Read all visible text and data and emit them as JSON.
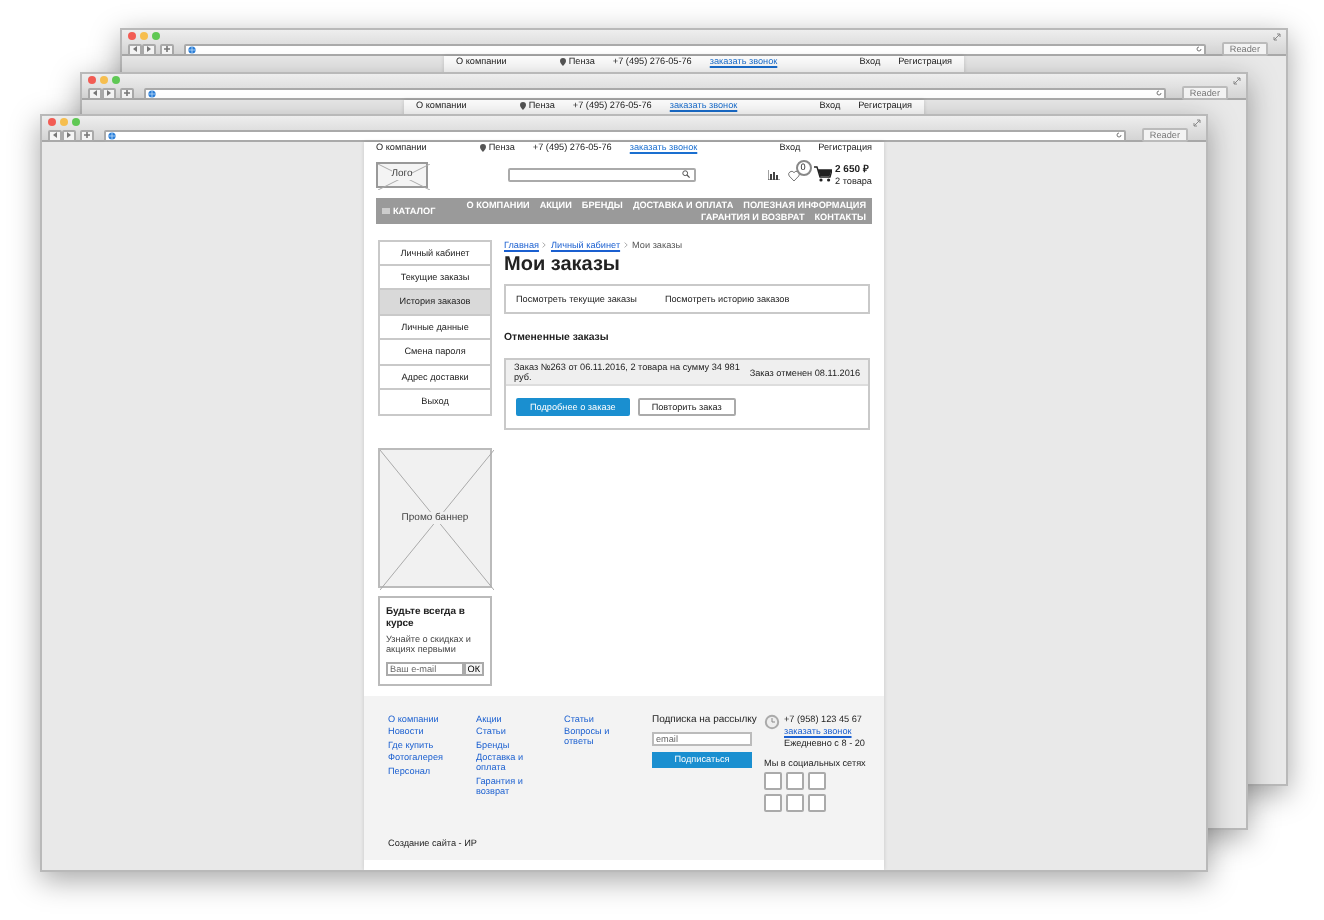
{
  "background_windows": [
    {
      "reader_button": "Reader",
      "top_bar": {
        "about": "О компании",
        "city": "Пенза",
        "phone": "+7 (495) 276-05-76",
        "callback": "заказать звонок",
        "login": "Вход",
        "register": "Регистрация"
      }
    },
    {
      "reader_button": "Reader",
      "top_bar": {
        "about": "О компании",
        "city": "Пенза",
        "phone": "+7 (495) 276-05-76",
        "callback": "заказать звонок",
        "login": "Вход",
        "register": "Регистрация"
      }
    }
  ],
  "window": {
    "reader_button": "Reader",
    "top_bar": {
      "about": "О компании",
      "city": "Пенза",
      "phone": "+7 (495) 276-05-76",
      "callback": "заказать звонок",
      "login": "Вход",
      "register": "Регистрация"
    },
    "header": {
      "logo": "Лого",
      "favorites_badge": "0",
      "cart_total": "2 650 ₽",
      "cart_count": "2 товара"
    },
    "nav": {
      "catalog": "КАТАЛОГ",
      "items": [
        "О КОМПАНИИ",
        "АКЦИИ",
        "БРЕНДЫ",
        "ДОСТАВКА И ОПЛАТА",
        "ПОЛЕЗНАЯ ИНФОРМАЦИЯ",
        "ГАРАНТИЯ И ВОЗВРАТ",
        "КОНТАКТЫ"
      ]
    },
    "sidebar": {
      "items": [
        {
          "label": "Личный кабинет",
          "selected": false
        },
        {
          "label": "Текущие заказы",
          "selected": false
        },
        {
          "label": "История заказов",
          "selected": true
        },
        {
          "label": "Личные данные",
          "selected": false
        },
        {
          "label": "Смена пароля",
          "selected": false
        },
        {
          "label": "Адрес доставки",
          "selected": false
        },
        {
          "label": "Выход",
          "selected": false
        }
      ]
    },
    "promo_banner": "Промо баннер",
    "subscribe_box": {
      "title": "Будьте всегда в курсе",
      "text": "Узнайте о скидках и акциях первыми",
      "placeholder": "Ваш e-mail",
      "button": "ОК"
    },
    "breadcrumbs": [
      "Главная",
      "Личный кабинет",
      "Мои заказы"
    ],
    "title": "Мои заказы",
    "tabs": [
      "Посмотреть текущие заказы",
      "Посмотреть историю заказов"
    ],
    "section_title": "Отмененные заказы",
    "orders": [
      {
        "summary": "Заказ №263 от 06.11.2016, 2 товара на сумму 34 981 руб.",
        "status": "Заказ отменен 08.11.2016",
        "buttons": [
          {
            "label": "Подробнее о заказе",
            "kind": "primary"
          },
          {
            "label": "Повторить заказ",
            "kind": "secondary"
          }
        ]
      }
    ],
    "footer": {
      "columns": [
        [
          "О компании",
          "Новости",
          "Где купить",
          "Фотогалерея",
          "Персонал"
        ],
        [
          "Акции",
          "Статьи",
          "Бренды",
          "Доставка и оплата",
          "Гарантия и возврат"
        ],
        [
          "Статьи",
          "Вопросы и ответы"
        ]
      ],
      "credit": "Создание сайта - ИР",
      "newsletter": {
        "title": "Подписка на рассылку",
        "placeholder": "email",
        "button": "Подписаться"
      },
      "contacts": {
        "phone": "+7 (958) 123 45 67",
        "callback": "заказать звонок",
        "hours": "Ежедневно с 8 - 20"
      },
      "social": {
        "title": "Мы в социальных сетях"
      }
    }
  }
}
